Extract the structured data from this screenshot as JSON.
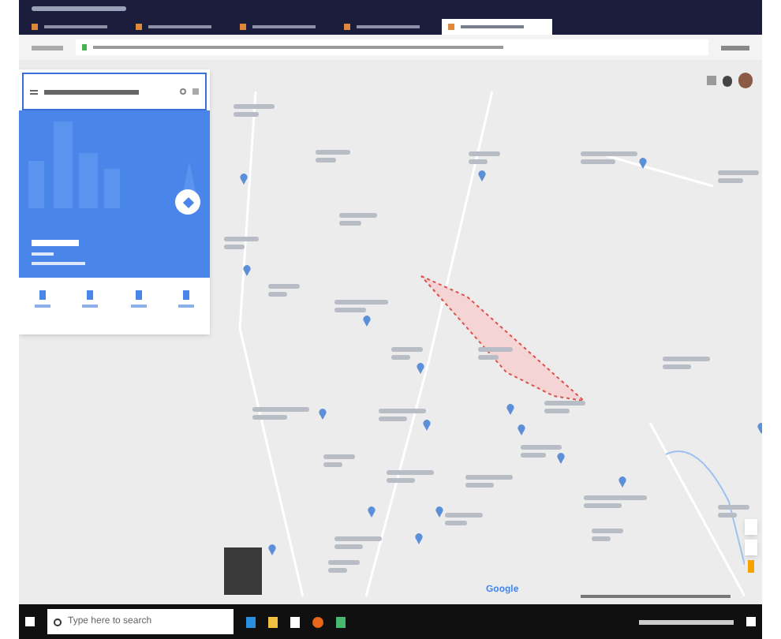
{
  "browser": {
    "tabs": [
      {
        "selected": false
      },
      {
        "selected": false
      },
      {
        "selected": false
      },
      {
        "selected": false
      },
      {
        "selected": true
      }
    ]
  },
  "map": {
    "logo": "Google"
  },
  "taskbar": {
    "search": {
      "placeholder": "Type here to search"
    }
  }
}
